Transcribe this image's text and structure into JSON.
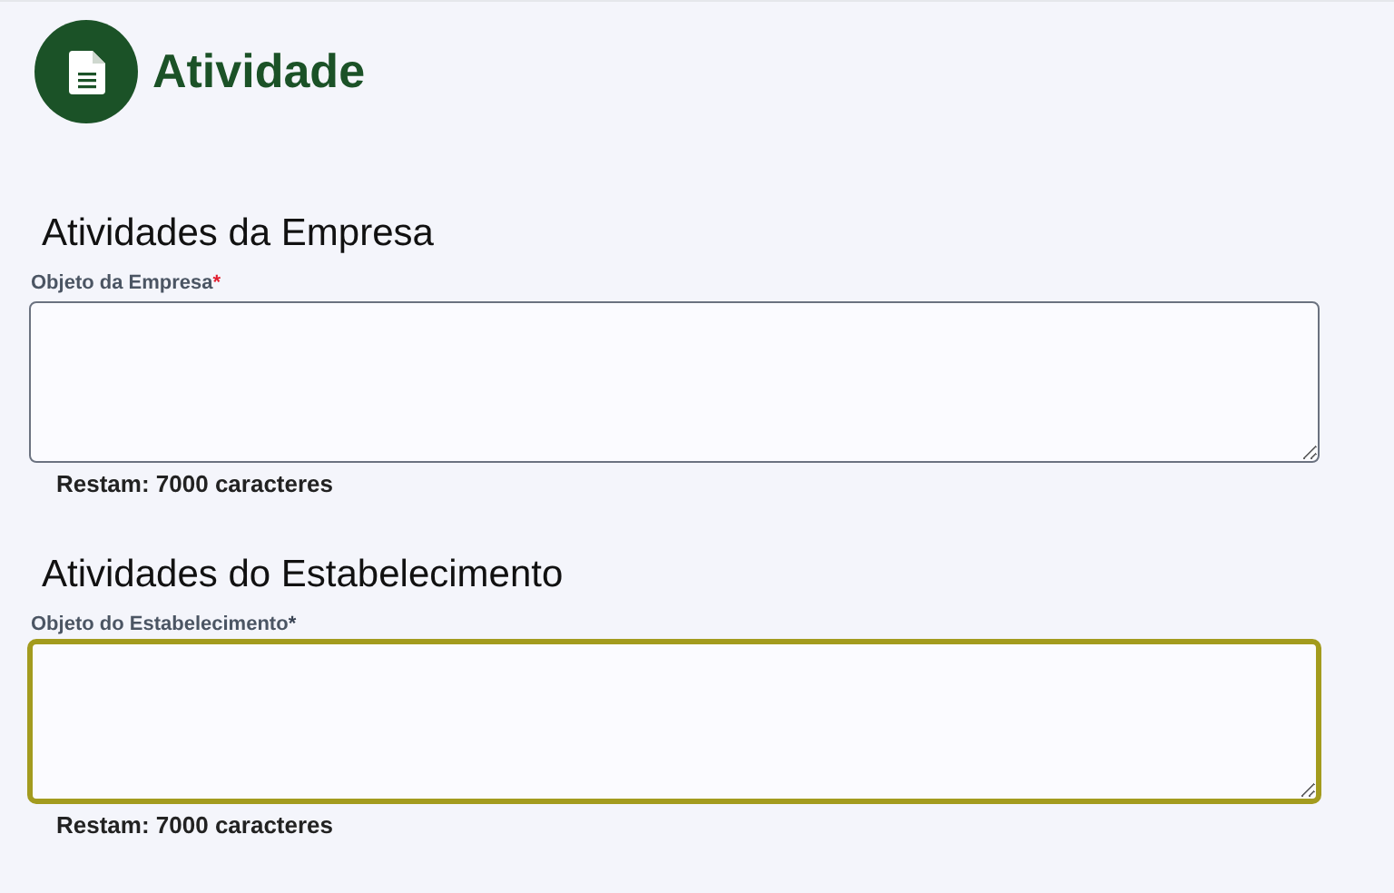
{
  "header": {
    "title": "Atividade"
  },
  "sections": [
    {
      "heading": "Atividades da Empresa",
      "label": "Objeto da Empresa",
      "required_mark": "*",
      "focused": false,
      "counter": "Restam: 7000 caracteres"
    },
    {
      "heading": "Atividades do Estabelecimento",
      "label": "Objeto do Estabelecimento",
      "required_mark": "*",
      "focused": true,
      "counter": "Restam: 7000 caracteres"
    }
  ]
}
